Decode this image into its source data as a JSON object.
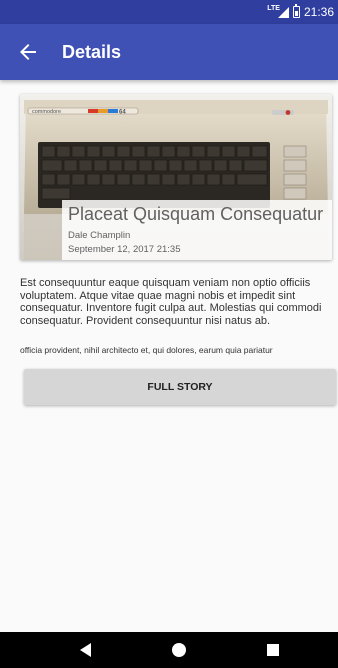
{
  "status_bar": {
    "network": "LTE",
    "time": "21:36",
    "icons": [
      "lte-signal-icon",
      "battery-icon"
    ]
  },
  "app_bar": {
    "title": "Details",
    "back_icon": "arrow-back-icon"
  },
  "hero": {
    "image_subject": "commodore-64-computer",
    "brand_text": "commodore",
    "model_text": "64",
    "headline": "Placeat Quisquam Consequatur",
    "author": "Dale Champlin",
    "date": "September 12, 2017 21:35"
  },
  "article": {
    "body": "Est consequuntur eaque quisquam veniam non optio officiis voluptatem. Atque vitae quae magni nobis et impedit sint consequatur. Inventore fugit culpa aut. Molestias qui commodi consequatur. Provident consequuntur nisi natus ab.",
    "excerpt": "officia provident, nihil architecto et, qui dolores, earum quia pariatur"
  },
  "actions": {
    "full_story_label": "FULL STORY"
  },
  "nav_bar": {
    "icons": [
      "nav-back-icon",
      "nav-home-icon",
      "nav-recents-icon"
    ]
  },
  "colors": {
    "status_bar": "#303f9f",
    "app_bar": "#3f51b5",
    "button": "#d6d6d6",
    "nav_bar": "#000000"
  }
}
